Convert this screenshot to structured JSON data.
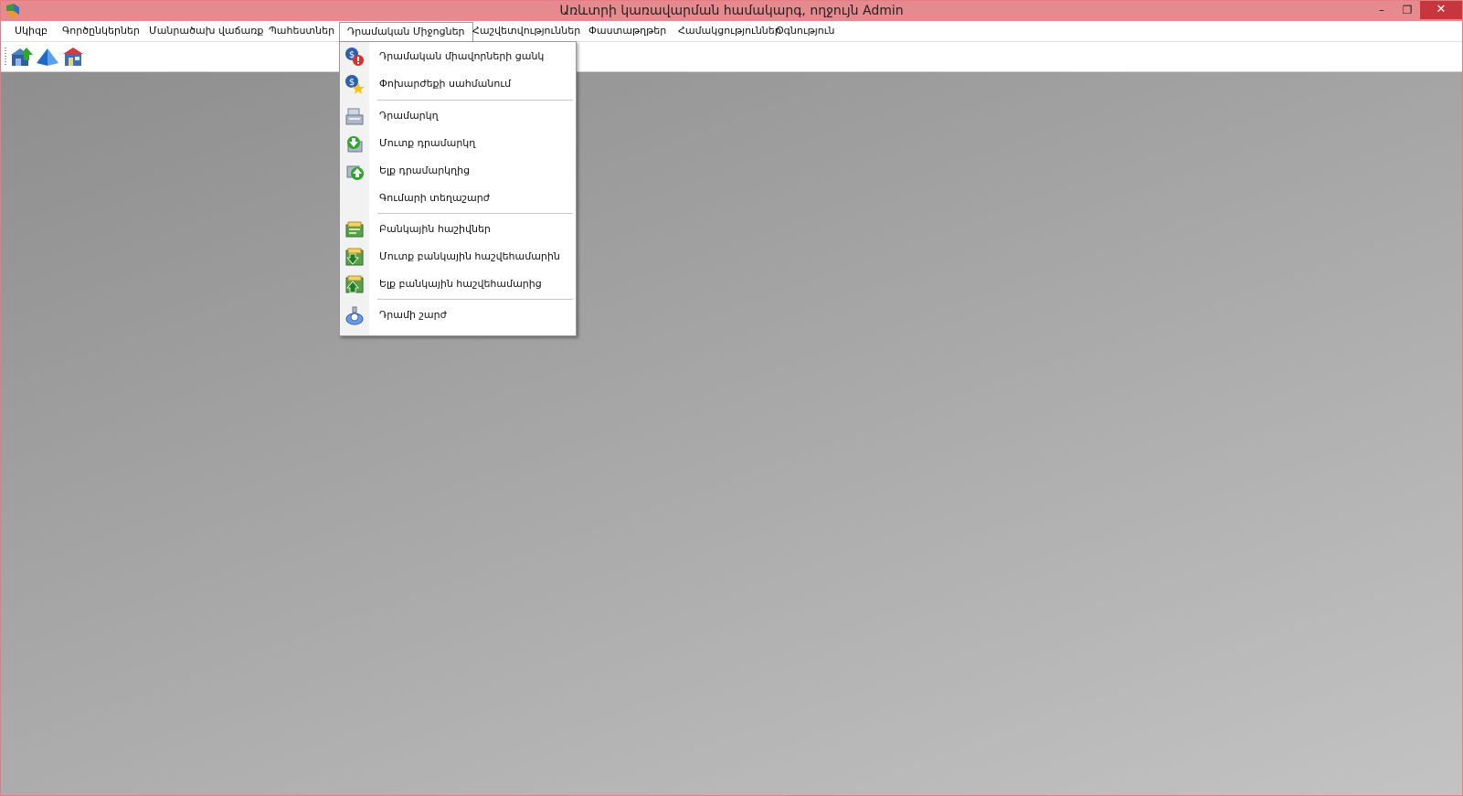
{
  "window": {
    "title": "Առևտրի կառավարման համակարգ, ողջույն Admin",
    "minimize_label": "–",
    "restore_label": "❐",
    "close_label": "✕",
    "accent_color": "#e78a8f",
    "close_color": "#c7363c"
  },
  "menubar": {
    "items": [
      {
        "label": "Սկիզբ"
      },
      {
        "label": "Գործընկերներ"
      },
      {
        "label": "Մանրածախ վաճառք"
      },
      {
        "label": "Պահեստներ"
      },
      {
        "label": "Դրամական Միջոցներ"
      },
      {
        "label": "Հաշվետվություններ"
      },
      {
        "label": "Փաստաթղթեր"
      },
      {
        "label": "Համակցություններ"
      },
      {
        "label": "Օգնություն"
      }
    ]
  },
  "toolbar": {
    "buttons": [
      {
        "icon": "warehouse-upload-icon"
      },
      {
        "icon": "pyramid-icon"
      },
      {
        "icon": "store-icon"
      }
    ]
  },
  "dropdown": {
    "items": [
      {
        "label": "Դրամական միավորների ցանկ",
        "icon": "currency-list-icon"
      },
      {
        "label": "Փոխարժեքի սահմանում",
        "icon": "exchange-rate-icon"
      },
      {
        "label": "Դրամարկղ",
        "icon": "cash-register-icon"
      },
      {
        "label": "Մուտք դրամարկղ",
        "icon": "cash-in-icon"
      },
      {
        "label": "Ելք դրամարկղից",
        "icon": "cash-out-icon"
      },
      {
        "label": "Գումարի տեղաշարժ",
        "icon": "none"
      },
      {
        "label": "Բանկային հաշիվներ",
        "icon": "bank-accounts-icon"
      },
      {
        "label": "Մուտք բանկային հաշվեհամարին",
        "icon": "bank-deposit-icon"
      },
      {
        "label": "Ելք բանկային հաշվեհամարից",
        "icon": "bank-withdraw-icon"
      },
      {
        "label": "Դրամի շարժ",
        "icon": "money-flow-icon"
      }
    ]
  }
}
